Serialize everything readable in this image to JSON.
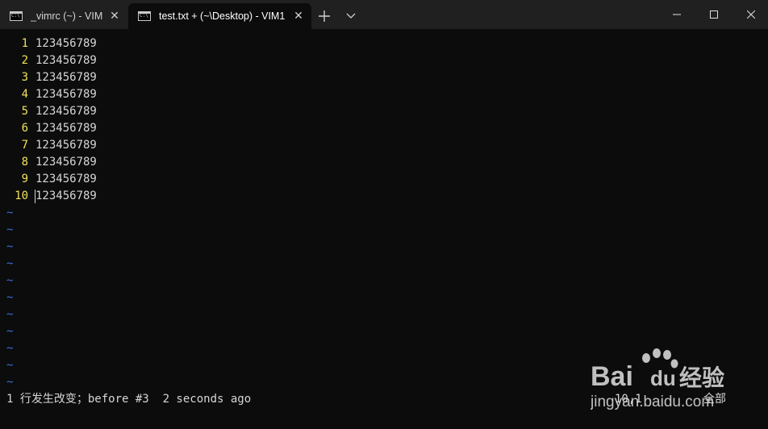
{
  "tabs": [
    {
      "title": "_vimrc (~) - VIM",
      "active": false
    },
    {
      "title": "test.txt + (~\\Desktop) - VIM1",
      "active": true
    }
  ],
  "icons": {
    "tab_icon": "terminal-icon",
    "close": "close-icon",
    "new_tab": "plus-icon",
    "dropdown": "chevron-down-icon",
    "minimize": "minimize-icon",
    "maximize": "maximize-icon",
    "window_close": "close-icon"
  },
  "editor": {
    "lines": [
      {
        "number": "1",
        "text": "123456789"
      },
      {
        "number": "2",
        "text": "123456789"
      },
      {
        "number": "3",
        "text": "123456789"
      },
      {
        "number": "4",
        "text": "123456789"
      },
      {
        "number": "5",
        "text": "123456789"
      },
      {
        "number": "6",
        "text": "123456789"
      },
      {
        "number": "7",
        "text": "123456789"
      },
      {
        "number": "8",
        "text": "123456789"
      },
      {
        "number": "9",
        "text": "123456789"
      },
      {
        "number": "10",
        "text": "123456789"
      }
    ],
    "tilde": "~",
    "tilde_count": 11
  },
  "status": {
    "message": "1 行发生改变；before #3  2 seconds ago",
    "cursor_position": "10,1",
    "scroll": "全部"
  },
  "watermark": {
    "brand": "Bai",
    "brand_suffix": "du",
    "cn": "经验",
    "url": "jingyan.baidu.com"
  },
  "colors": {
    "background": "#0c0c0c",
    "titlebar": "#202020",
    "line_number": "#f2e15b",
    "text": "#d6d6d6",
    "tilde": "#3b6fd8"
  }
}
